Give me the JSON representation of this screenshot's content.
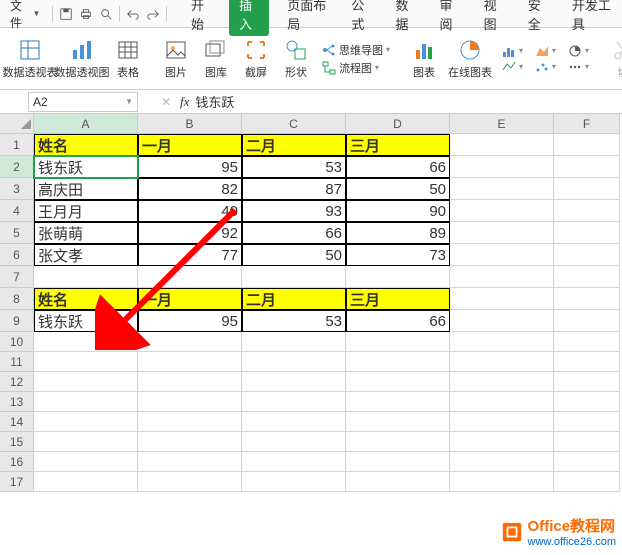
{
  "topbar": {
    "menu_label": "文件",
    "tabs": [
      "开始",
      "插入",
      "页面布局",
      "公式",
      "数据",
      "审阅",
      "视图",
      "安全",
      "开发工具"
    ],
    "active_tab": "插入"
  },
  "ribbon": {
    "pivot_table": "数据透视表",
    "pivot_chart": "数据透视图",
    "table": "表格",
    "picture": "图片",
    "gallery": "图库",
    "screenshot": "截屏",
    "shapes": "形状",
    "mindmap": "思维导图",
    "flowchart": "流程图",
    "chart": "图表",
    "online_chart": "在线图表"
  },
  "name_box": "A2",
  "formula_value": "钱东跃",
  "columns": [
    "A",
    "B",
    "C",
    "D",
    "E",
    "F"
  ],
  "rows": [
    1,
    2,
    3,
    4,
    5,
    6,
    7,
    8,
    9,
    10,
    11,
    12,
    13,
    14,
    15,
    16,
    17
  ],
  "active_cell": {
    "row": 2,
    "col": "A"
  },
  "table1": {
    "header_row": 1,
    "headers": [
      "姓名",
      "一月",
      "二月",
      "三月"
    ],
    "data": [
      [
        "钱东跃",
        95,
        53,
        66
      ],
      [
        "高庆田",
        82,
        87,
        50
      ],
      [
        "王月月",
        40,
        93,
        90
      ],
      [
        "张萌萌",
        92,
        66,
        89
      ],
      [
        "张文孝",
        77,
        50,
        73
      ]
    ]
  },
  "table2": {
    "header_row": 8,
    "headers": [
      "姓名",
      "一月",
      "二月",
      "三月"
    ],
    "data": [
      [
        "钱东跃",
        95,
        53,
        66
      ]
    ]
  },
  "watermark": {
    "brand": "Office教程网",
    "url": "www.office26.com"
  }
}
